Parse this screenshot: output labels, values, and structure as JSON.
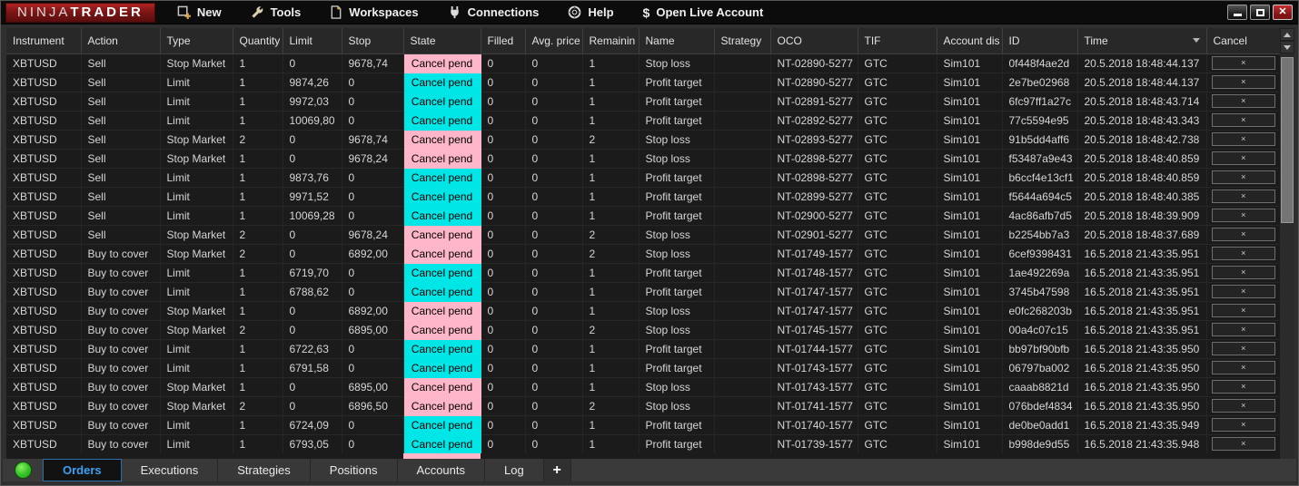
{
  "topbar": {
    "menus": [
      {
        "label": "New",
        "icon": "new-window-icon"
      },
      {
        "label": "Tools",
        "icon": "wrench-icon"
      },
      {
        "label": "Workspaces",
        "icon": "workspace-document-icon"
      },
      {
        "label": "Connections",
        "icon": "plug-icon"
      },
      {
        "label": "Help",
        "icon": "lifebuoy-icon"
      },
      {
        "label": "Open Live Account",
        "icon": "dollar-icon"
      }
    ],
    "window_controls": [
      "minimize",
      "maximize",
      "close"
    ]
  },
  "table": {
    "columns": [
      {
        "key": "instrument",
        "label": "Instrument"
      },
      {
        "key": "action",
        "label": "Action"
      },
      {
        "key": "type",
        "label": "Type"
      },
      {
        "key": "quantity",
        "label": "Quantity"
      },
      {
        "key": "limit",
        "label": "Limit"
      },
      {
        "key": "stop",
        "label": "Stop"
      },
      {
        "key": "state",
        "label": "State"
      },
      {
        "key": "filled",
        "label": "Filled"
      },
      {
        "key": "avg_price",
        "label": "Avg. price"
      },
      {
        "key": "remaining",
        "label": "Remainin"
      },
      {
        "key": "name",
        "label": "Name"
      },
      {
        "key": "strategy",
        "label": "Strategy"
      },
      {
        "key": "oco",
        "label": "OCO"
      },
      {
        "key": "tif",
        "label": "TIF"
      },
      {
        "key": "account",
        "label": "Account dis"
      },
      {
        "key": "id",
        "label": "ID"
      },
      {
        "key": "time",
        "label": "Time",
        "sort": "desc"
      },
      {
        "key": "cancel",
        "label": "Cancel"
      }
    ],
    "state_colors": {
      "stop_market": "#ffb6c8",
      "limit": "#00e5e5"
    },
    "partial_row": {
      "state_color": "#ffb6c8"
    },
    "rows": [
      {
        "instrument": "XBTUSD",
        "action": "Sell",
        "type": "Stop Market",
        "quantity": "1",
        "limit": "0",
        "stop": "9678,74",
        "state": "Cancel pend",
        "state_color": "#ffb6c8",
        "filled": "0",
        "avg_price": "0",
        "remaining": "1",
        "name": "Stop loss",
        "strategy": "",
        "oco": "NT-02890-5277",
        "tif": "GTC",
        "account": "Sim101",
        "id": "0f448f4ae2d",
        "time": "20.5.2018 18:48:44.137",
        "cancel": "×"
      },
      {
        "instrument": "XBTUSD",
        "action": "Sell",
        "type": "Limit",
        "quantity": "1",
        "limit": "9874,26",
        "stop": "0",
        "state": "Cancel pend",
        "state_color": "#00e5e5",
        "filled": "0",
        "avg_price": "0",
        "remaining": "1",
        "name": "Profit target",
        "strategy": "",
        "oco": "NT-02890-5277",
        "tif": "GTC",
        "account": "Sim101",
        "id": "2e7be02968",
        "time": "20.5.2018 18:48:44.137",
        "cancel": "×"
      },
      {
        "instrument": "XBTUSD",
        "action": "Sell",
        "type": "Limit",
        "quantity": "1",
        "limit": "9972,03",
        "stop": "0",
        "state": "Cancel pend",
        "state_color": "#00e5e5",
        "filled": "0",
        "avg_price": "0",
        "remaining": "1",
        "name": "Profit target",
        "strategy": "",
        "oco": "NT-02891-5277",
        "tif": "GTC",
        "account": "Sim101",
        "id": "6fc97ff1a27c",
        "time": "20.5.2018 18:48:43.714",
        "cancel": "×"
      },
      {
        "instrument": "XBTUSD",
        "action": "Sell",
        "type": "Limit",
        "quantity": "1",
        "limit": "10069,80",
        "stop": "0",
        "state": "Cancel pend",
        "state_color": "#00e5e5",
        "filled": "0",
        "avg_price": "0",
        "remaining": "1",
        "name": "Profit target",
        "strategy": "",
        "oco": "NT-02892-5277",
        "tif": "GTC",
        "account": "Sim101",
        "id": "77c5594e95",
        "time": "20.5.2018 18:48:43.343",
        "cancel": "×"
      },
      {
        "instrument": "XBTUSD",
        "action": "Sell",
        "type": "Stop Market",
        "quantity": "2",
        "limit": "0",
        "stop": "9678,74",
        "state": "Cancel pend",
        "state_color": "#ffb6c8",
        "filled": "0",
        "avg_price": "0",
        "remaining": "2",
        "name": "Stop loss",
        "strategy": "",
        "oco": "NT-02893-5277",
        "tif": "GTC",
        "account": "Sim101",
        "id": "91b5dd4aff6",
        "time": "20.5.2018 18:48:42.738",
        "cancel": "×"
      },
      {
        "instrument": "XBTUSD",
        "action": "Sell",
        "type": "Stop Market",
        "quantity": "1",
        "limit": "0",
        "stop": "9678,24",
        "state": "Cancel pend",
        "state_color": "#ffb6c8",
        "filled": "0",
        "avg_price": "0",
        "remaining": "1",
        "name": "Stop loss",
        "strategy": "",
        "oco": "NT-02898-5277",
        "tif": "GTC",
        "account": "Sim101",
        "id": "f53487a9e43",
        "time": "20.5.2018 18:48:40.859",
        "cancel": "×"
      },
      {
        "instrument": "XBTUSD",
        "action": "Sell",
        "type": "Limit",
        "quantity": "1",
        "limit": "9873,76",
        "stop": "0",
        "state": "Cancel pend",
        "state_color": "#00e5e5",
        "filled": "0",
        "avg_price": "0",
        "remaining": "1",
        "name": "Profit target",
        "strategy": "",
        "oco": "NT-02898-5277",
        "tif": "GTC",
        "account": "Sim101",
        "id": "b6ccf4e13cf1",
        "time": "20.5.2018 18:48:40.859",
        "cancel": "×"
      },
      {
        "instrument": "XBTUSD",
        "action": "Sell",
        "type": "Limit",
        "quantity": "1",
        "limit": "9971,52",
        "stop": "0",
        "state": "Cancel pend",
        "state_color": "#00e5e5",
        "filled": "0",
        "avg_price": "0",
        "remaining": "1",
        "name": "Profit target",
        "strategy": "",
        "oco": "NT-02899-5277",
        "tif": "GTC",
        "account": "Sim101",
        "id": "f5644a694c5",
        "time": "20.5.2018 18:48:40.385",
        "cancel": "×"
      },
      {
        "instrument": "XBTUSD",
        "action": "Sell",
        "type": "Limit",
        "quantity": "1",
        "limit": "10069,28",
        "stop": "0",
        "state": "Cancel pend",
        "state_color": "#00e5e5",
        "filled": "0",
        "avg_price": "0",
        "remaining": "1",
        "name": "Profit target",
        "strategy": "",
        "oco": "NT-02900-5277",
        "tif": "GTC",
        "account": "Sim101",
        "id": "4ac86afb7d5",
        "time": "20.5.2018 18:48:39.909",
        "cancel": "×"
      },
      {
        "instrument": "XBTUSD",
        "action": "Sell",
        "type": "Stop Market",
        "quantity": "2",
        "limit": "0",
        "stop": "9678,24",
        "state": "Cancel pend",
        "state_color": "#ffb6c8",
        "filled": "0",
        "avg_price": "0",
        "remaining": "2",
        "name": "Stop loss",
        "strategy": "",
        "oco": "NT-02901-5277",
        "tif": "GTC",
        "account": "Sim101",
        "id": "b2254bb7a3",
        "time": "20.5.2018 18:48:37.689",
        "cancel": "×"
      },
      {
        "instrument": "XBTUSD",
        "action": "Buy to cover",
        "type": "Stop Market",
        "quantity": "2",
        "limit": "0",
        "stop": "6892,00",
        "state": "Cancel pend",
        "state_color": "#ffb6c8",
        "filled": "0",
        "avg_price": "0",
        "remaining": "2",
        "name": "Stop loss",
        "strategy": "",
        "oco": "NT-01749-1577",
        "tif": "GTC",
        "account": "Sim101",
        "id": "6cef9398431",
        "time": "16.5.2018 21:43:35.951",
        "cancel": "×"
      },
      {
        "instrument": "XBTUSD",
        "action": "Buy to cover",
        "type": "Limit",
        "quantity": "1",
        "limit": "6719,70",
        "stop": "0",
        "state": "Cancel pend",
        "state_color": "#00e5e5",
        "filled": "0",
        "avg_price": "0",
        "remaining": "1",
        "name": "Profit target",
        "strategy": "",
        "oco": "NT-01748-1577",
        "tif": "GTC",
        "account": "Sim101",
        "id": "1ae492269a",
        "time": "16.5.2018 21:43:35.951",
        "cancel": "×"
      },
      {
        "instrument": "XBTUSD",
        "action": "Buy to cover",
        "type": "Limit",
        "quantity": "1",
        "limit": "6788,62",
        "stop": "0",
        "state": "Cancel pend",
        "state_color": "#00e5e5",
        "filled": "0",
        "avg_price": "0",
        "remaining": "1",
        "name": "Profit target",
        "strategy": "",
        "oco": "NT-01747-1577",
        "tif": "GTC",
        "account": "Sim101",
        "id": "3745b47598",
        "time": "16.5.2018 21:43:35.951",
        "cancel": "×"
      },
      {
        "instrument": "XBTUSD",
        "action": "Buy to cover",
        "type": "Stop Market",
        "quantity": "1",
        "limit": "0",
        "stop": "6892,00",
        "state": "Cancel pend",
        "state_color": "#ffb6c8",
        "filled": "0",
        "avg_price": "0",
        "remaining": "1",
        "name": "Stop loss",
        "strategy": "",
        "oco": "NT-01747-1577",
        "tif": "GTC",
        "account": "Sim101",
        "id": "e0fc268203b",
        "time": "16.5.2018 21:43:35.951",
        "cancel": "×"
      },
      {
        "instrument": "XBTUSD",
        "action": "Buy to cover",
        "type": "Stop Market",
        "quantity": "2",
        "limit": "0",
        "stop": "6895,00",
        "state": "Cancel pend",
        "state_color": "#ffb6c8",
        "filled": "0",
        "avg_price": "0",
        "remaining": "2",
        "name": "Stop loss",
        "strategy": "",
        "oco": "NT-01745-1577",
        "tif": "GTC",
        "account": "Sim101",
        "id": "00a4c07c15",
        "time": "16.5.2018 21:43:35.951",
        "cancel": "×"
      },
      {
        "instrument": "XBTUSD",
        "action": "Buy to cover",
        "type": "Limit",
        "quantity": "1",
        "limit": "6722,63",
        "stop": "0",
        "state": "Cancel pend",
        "state_color": "#00e5e5",
        "filled": "0",
        "avg_price": "0",
        "remaining": "1",
        "name": "Profit target",
        "strategy": "",
        "oco": "NT-01744-1577",
        "tif": "GTC",
        "account": "Sim101",
        "id": "bb97bf90bfb",
        "time": "16.5.2018 21:43:35.950",
        "cancel": "×"
      },
      {
        "instrument": "XBTUSD",
        "action": "Buy to cover",
        "type": "Limit",
        "quantity": "1",
        "limit": "6791,58",
        "stop": "0",
        "state": "Cancel pend",
        "state_color": "#00e5e5",
        "filled": "0",
        "avg_price": "0",
        "remaining": "1",
        "name": "Profit target",
        "strategy": "",
        "oco": "NT-01743-1577",
        "tif": "GTC",
        "account": "Sim101",
        "id": "06797ba002",
        "time": "16.5.2018 21:43:35.950",
        "cancel": "×"
      },
      {
        "instrument": "XBTUSD",
        "action": "Buy to cover",
        "type": "Stop Market",
        "quantity": "1",
        "limit": "0",
        "stop": "6895,00",
        "state": "Cancel pend",
        "state_color": "#ffb6c8",
        "filled": "0",
        "avg_price": "0",
        "remaining": "1",
        "name": "Stop loss",
        "strategy": "",
        "oco": "NT-01743-1577",
        "tif": "GTC",
        "account": "Sim101",
        "id": "caaab8821d",
        "time": "16.5.2018 21:43:35.950",
        "cancel": "×"
      },
      {
        "instrument": "XBTUSD",
        "action": "Buy to cover",
        "type": "Stop Market",
        "quantity": "2",
        "limit": "0",
        "stop": "6896,50",
        "state": "Cancel pend",
        "state_color": "#ffb6c8",
        "filled": "0",
        "avg_price": "0",
        "remaining": "2",
        "name": "Stop loss",
        "strategy": "",
        "oco": "NT-01741-1577",
        "tif": "GTC",
        "account": "Sim101",
        "id": "076bdef4834",
        "time": "16.5.2018 21:43:35.950",
        "cancel": "×"
      },
      {
        "instrument": "XBTUSD",
        "action": "Buy to cover",
        "type": "Limit",
        "quantity": "1",
        "limit": "6724,09",
        "stop": "0",
        "state": "Cancel pend",
        "state_color": "#00e5e5",
        "filled": "0",
        "avg_price": "0",
        "remaining": "1",
        "name": "Profit target",
        "strategy": "",
        "oco": "NT-01740-1577",
        "tif": "GTC",
        "account": "Sim101",
        "id": "de0be0add1",
        "time": "16.5.2018 21:43:35.949",
        "cancel": "×"
      },
      {
        "instrument": "XBTUSD",
        "action": "Buy to cover",
        "type": "Limit",
        "quantity": "1",
        "limit": "6793,05",
        "stop": "0",
        "state": "Cancel pend",
        "state_color": "#00e5e5",
        "filled": "0",
        "avg_price": "0",
        "remaining": "1",
        "name": "Profit target",
        "strategy": "",
        "oco": "NT-01739-1577",
        "tif": "GTC",
        "account": "Sim101",
        "id": "b998de9d55",
        "time": "16.5.2018 21:43:35.948",
        "cancel": "×"
      }
    ]
  },
  "statusbar": {
    "connection_status_color": "#35c224",
    "tabs": [
      {
        "label": "Orders",
        "active": true
      },
      {
        "label": "Executions",
        "active": false
      },
      {
        "label": "Strategies",
        "active": false
      },
      {
        "label": "Positions",
        "active": false
      },
      {
        "label": "Accounts",
        "active": false
      },
      {
        "label": "Log",
        "active": false
      }
    ],
    "add_tab_label": "+"
  },
  "colors": {
    "logo_red": "#8f1a1a",
    "active_tab_blue": "#3da0f5",
    "state_stop_market": "#ffb6c8",
    "state_limit": "#00e5e5"
  },
  "logo": {
    "ninja": "NINJA",
    "trader": "TRADER"
  }
}
